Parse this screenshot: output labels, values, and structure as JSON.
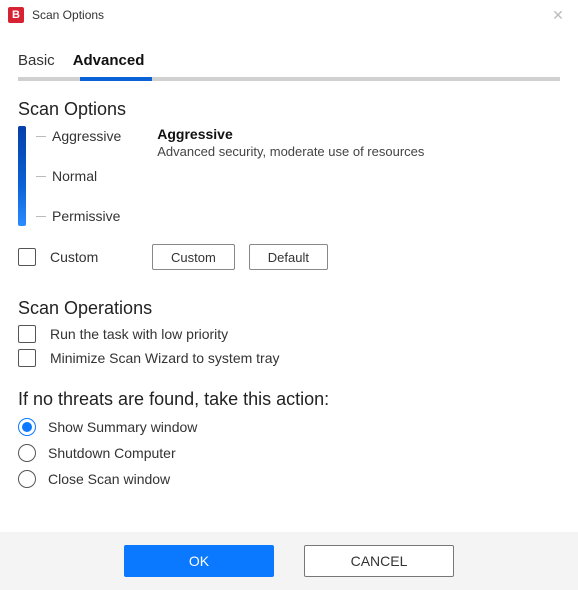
{
  "window": {
    "title": "Scan Options",
    "app_icon_letter": "B"
  },
  "tabs": {
    "basic": "Basic",
    "advanced": "Advanced",
    "active": "advanced"
  },
  "scan_options": {
    "title": "Scan Options",
    "levels": [
      "Aggressive",
      "Normal",
      "Permissive"
    ],
    "selected": "Aggressive",
    "selected_name": "Aggressive",
    "selected_desc": "Advanced security, moderate use of resources",
    "custom_label": "Custom",
    "custom_checked": false,
    "custom_button": "Custom",
    "default_button": "Default"
  },
  "scan_operations": {
    "title": "Scan Operations",
    "items": [
      {
        "label": "Run the task with low priority",
        "checked": false
      },
      {
        "label": "Minimize Scan Wizard to system tray",
        "checked": false
      }
    ]
  },
  "no_threats": {
    "title": "If no threats are found, take this action:",
    "options": [
      {
        "label": "Show Summary window",
        "selected": true
      },
      {
        "label": "Shutdown Computer",
        "selected": false
      },
      {
        "label": "Close Scan window",
        "selected": false
      }
    ]
  },
  "footer": {
    "ok": "OK",
    "cancel": "CANCEL"
  }
}
